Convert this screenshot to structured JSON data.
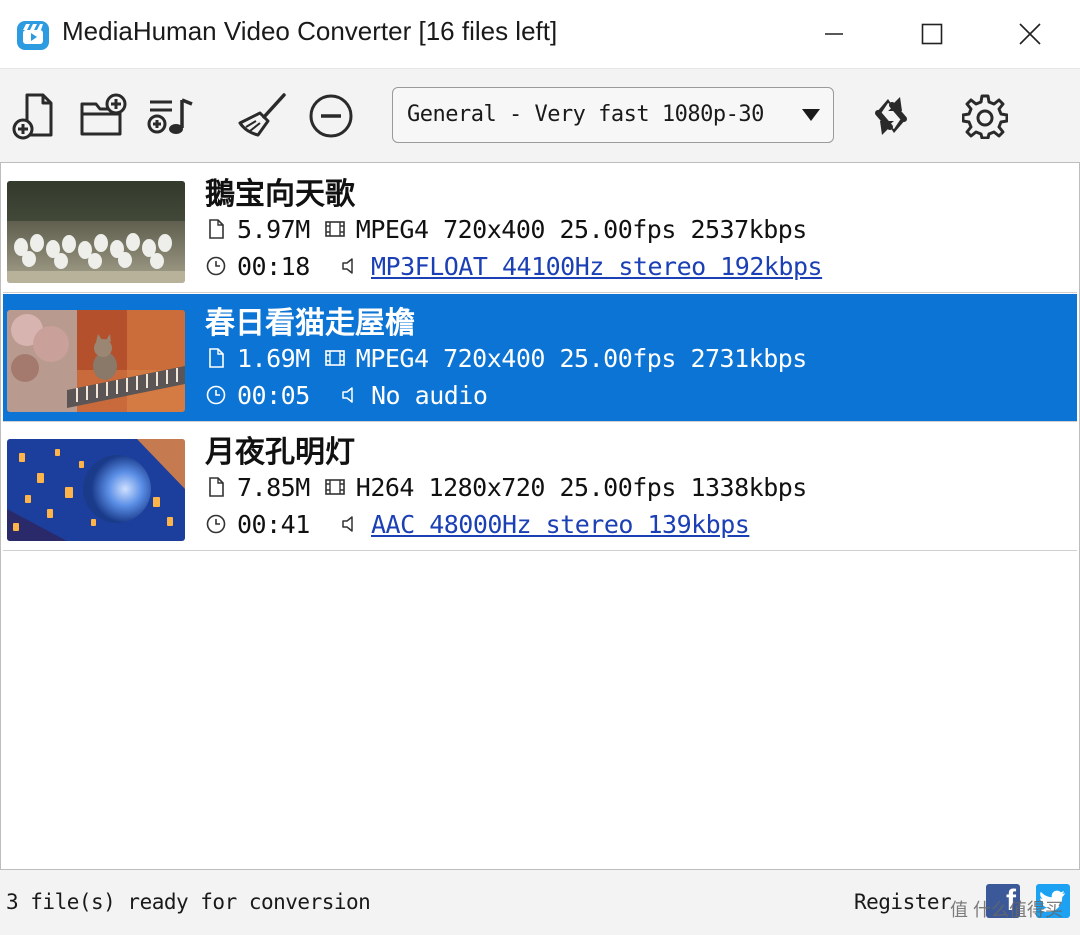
{
  "window": {
    "title": "MediaHuman Video Converter [16 files left]"
  },
  "toolbar": {
    "profile": "General - Very fast 1080p-30",
    "icons": [
      "add-file-icon",
      "add-folder-icon",
      "add-music-icon",
      "clean-broom-icon",
      "remove-icon",
      "convert-icon",
      "gear-icon"
    ]
  },
  "files": [
    {
      "name": "鵝宝向天歌",
      "size": "5.97M",
      "video": "MPEG4 720x400 25.00fps 2537kbps",
      "duration": "00:18",
      "audio": "MP3FLOAT 44100Hz stereo 192kbps",
      "audio_is_link": true,
      "selected": false
    },
    {
      "name": "春日看猫走屋檐",
      "size": "1.69M",
      "video": "MPEG4 720x400 25.00fps 2731kbps",
      "duration": "00:05",
      "audio": "No audio",
      "audio_is_link": false,
      "selected": true
    },
    {
      "name": "月夜孔明灯",
      "size": "7.85M",
      "video": "H264 1280x720 25.00fps 1338kbps",
      "duration": "00:41",
      "audio": "AAC 48000Hz stereo 139kbps",
      "audio_is_link": true,
      "selected": false
    }
  ],
  "status": {
    "text": "3 file(s) ready for conversion",
    "register": "Register",
    "watermark": "值 什么值得买"
  },
  "colors": {
    "selection": "#0c74d4",
    "link": "#1b3fb4",
    "facebook": "#3b5998",
    "twitter": "#1da1f2"
  }
}
